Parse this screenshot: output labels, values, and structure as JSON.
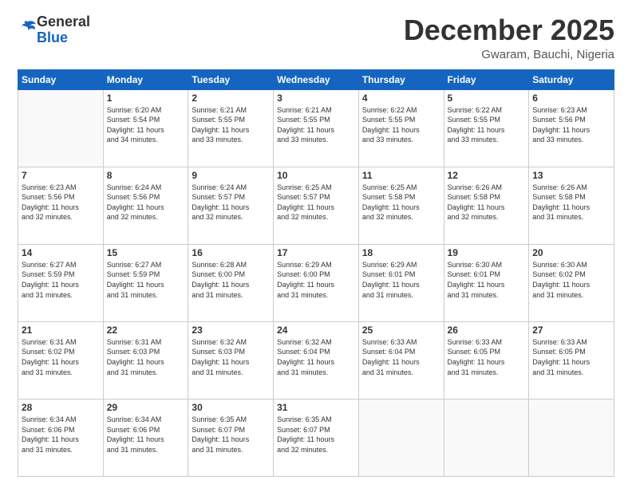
{
  "header": {
    "logo_general": "General",
    "logo_blue": "Blue",
    "month_title": "December 2025",
    "location": "Gwaram, Bauchi, Nigeria"
  },
  "weekdays": [
    "Sunday",
    "Monday",
    "Tuesday",
    "Wednesday",
    "Thursday",
    "Friday",
    "Saturday"
  ],
  "weeks": [
    [
      {
        "day": "",
        "info": ""
      },
      {
        "day": "1",
        "info": "Sunrise: 6:20 AM\nSunset: 5:54 PM\nDaylight: 11 hours\nand 34 minutes."
      },
      {
        "day": "2",
        "info": "Sunrise: 6:21 AM\nSunset: 5:55 PM\nDaylight: 11 hours\nand 33 minutes."
      },
      {
        "day": "3",
        "info": "Sunrise: 6:21 AM\nSunset: 5:55 PM\nDaylight: 11 hours\nand 33 minutes."
      },
      {
        "day": "4",
        "info": "Sunrise: 6:22 AM\nSunset: 5:55 PM\nDaylight: 11 hours\nand 33 minutes."
      },
      {
        "day": "5",
        "info": "Sunrise: 6:22 AM\nSunset: 5:55 PM\nDaylight: 11 hours\nand 33 minutes."
      },
      {
        "day": "6",
        "info": "Sunrise: 6:23 AM\nSunset: 5:56 PM\nDaylight: 11 hours\nand 33 minutes."
      }
    ],
    [
      {
        "day": "7",
        "info": "Sunrise: 6:23 AM\nSunset: 5:56 PM\nDaylight: 11 hours\nand 32 minutes."
      },
      {
        "day": "8",
        "info": "Sunrise: 6:24 AM\nSunset: 5:56 PM\nDaylight: 11 hours\nand 32 minutes."
      },
      {
        "day": "9",
        "info": "Sunrise: 6:24 AM\nSunset: 5:57 PM\nDaylight: 11 hours\nand 32 minutes."
      },
      {
        "day": "10",
        "info": "Sunrise: 6:25 AM\nSunset: 5:57 PM\nDaylight: 11 hours\nand 32 minutes."
      },
      {
        "day": "11",
        "info": "Sunrise: 6:25 AM\nSunset: 5:58 PM\nDaylight: 11 hours\nand 32 minutes."
      },
      {
        "day": "12",
        "info": "Sunrise: 6:26 AM\nSunset: 5:58 PM\nDaylight: 11 hours\nand 32 minutes."
      },
      {
        "day": "13",
        "info": "Sunrise: 6:26 AM\nSunset: 5:58 PM\nDaylight: 11 hours\nand 31 minutes."
      }
    ],
    [
      {
        "day": "14",
        "info": "Sunrise: 6:27 AM\nSunset: 5:59 PM\nDaylight: 11 hours\nand 31 minutes."
      },
      {
        "day": "15",
        "info": "Sunrise: 6:27 AM\nSunset: 5:59 PM\nDaylight: 11 hours\nand 31 minutes."
      },
      {
        "day": "16",
        "info": "Sunrise: 6:28 AM\nSunset: 6:00 PM\nDaylight: 11 hours\nand 31 minutes."
      },
      {
        "day": "17",
        "info": "Sunrise: 6:29 AM\nSunset: 6:00 PM\nDaylight: 11 hours\nand 31 minutes."
      },
      {
        "day": "18",
        "info": "Sunrise: 6:29 AM\nSunset: 6:01 PM\nDaylight: 11 hours\nand 31 minutes."
      },
      {
        "day": "19",
        "info": "Sunrise: 6:30 AM\nSunset: 6:01 PM\nDaylight: 11 hours\nand 31 minutes."
      },
      {
        "day": "20",
        "info": "Sunrise: 6:30 AM\nSunset: 6:02 PM\nDaylight: 11 hours\nand 31 minutes."
      }
    ],
    [
      {
        "day": "21",
        "info": "Sunrise: 6:31 AM\nSunset: 6:02 PM\nDaylight: 11 hours\nand 31 minutes."
      },
      {
        "day": "22",
        "info": "Sunrise: 6:31 AM\nSunset: 6:03 PM\nDaylight: 11 hours\nand 31 minutes."
      },
      {
        "day": "23",
        "info": "Sunrise: 6:32 AM\nSunset: 6:03 PM\nDaylight: 11 hours\nand 31 minutes."
      },
      {
        "day": "24",
        "info": "Sunrise: 6:32 AM\nSunset: 6:04 PM\nDaylight: 11 hours\nand 31 minutes."
      },
      {
        "day": "25",
        "info": "Sunrise: 6:33 AM\nSunset: 6:04 PM\nDaylight: 11 hours\nand 31 minutes."
      },
      {
        "day": "26",
        "info": "Sunrise: 6:33 AM\nSunset: 6:05 PM\nDaylight: 11 hours\nand 31 minutes."
      },
      {
        "day": "27",
        "info": "Sunrise: 6:33 AM\nSunset: 6:05 PM\nDaylight: 11 hours\nand 31 minutes."
      }
    ],
    [
      {
        "day": "28",
        "info": "Sunrise: 6:34 AM\nSunset: 6:06 PM\nDaylight: 11 hours\nand 31 minutes."
      },
      {
        "day": "29",
        "info": "Sunrise: 6:34 AM\nSunset: 6:06 PM\nDaylight: 11 hours\nand 31 minutes."
      },
      {
        "day": "30",
        "info": "Sunrise: 6:35 AM\nSunset: 6:07 PM\nDaylight: 11 hours\nand 31 minutes."
      },
      {
        "day": "31",
        "info": "Sunrise: 6:35 AM\nSunset: 6:07 PM\nDaylight: 11 hours\nand 32 minutes."
      },
      {
        "day": "",
        "info": ""
      },
      {
        "day": "",
        "info": ""
      },
      {
        "day": "",
        "info": ""
      }
    ]
  ]
}
